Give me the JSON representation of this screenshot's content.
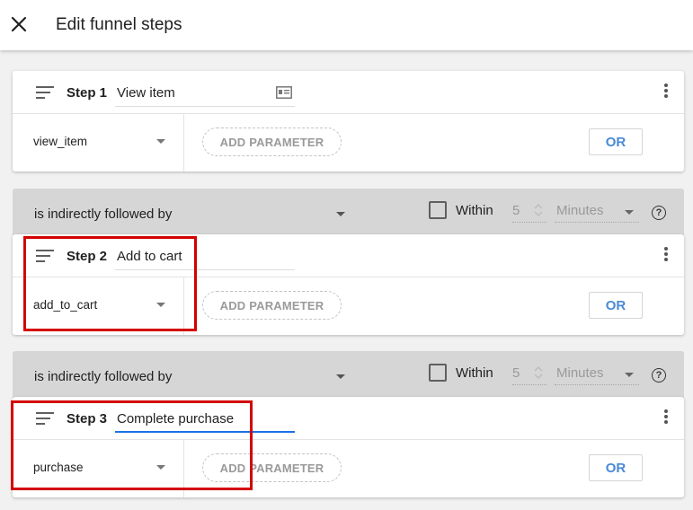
{
  "header": {
    "title": "Edit funnel steps",
    "close_icon": "close-icon"
  },
  "steps": [
    {
      "label": "Step 1",
      "name": "View item",
      "event": "view_item",
      "add_parameter": "ADD PARAMETER",
      "or": "OR"
    },
    {
      "label": "Step 2",
      "name": "Add to cart",
      "event": "add_to_cart",
      "add_parameter": "ADD PARAMETER",
      "or": "OR"
    },
    {
      "label": "Step 3",
      "name": "Complete purchase",
      "event": "purchase",
      "add_parameter": "ADD PARAMETER",
      "or": "OR"
    }
  ],
  "connectors": [
    {
      "relation": "is indirectly followed by",
      "within_label": "Within",
      "within_value": "5",
      "unit": "Minutes",
      "help": "?",
      "within_checked": false
    },
    {
      "relation": "is indirectly followed by",
      "within_label": "Within",
      "within_value": "5",
      "unit": "Minutes",
      "help": "?",
      "within_checked": false
    }
  ],
  "colors": {
    "accent": "#1a73e8",
    "highlight": "#d40000",
    "or_text": "#4a8ad5",
    "connector_bg": "#d6d6d6"
  }
}
